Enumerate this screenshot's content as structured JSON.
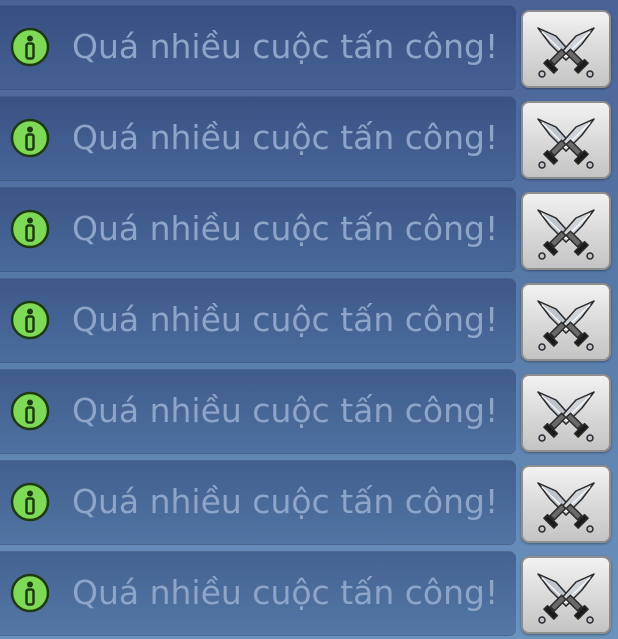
{
  "notifications": [
    {
      "message": "Quá nhiều cuộc tấn công!",
      "icon": "info-icon",
      "action_icon": "crossed-swords-icon"
    },
    {
      "message": "Quá nhiều cuộc tấn công!",
      "icon": "info-icon",
      "action_icon": "crossed-swords-icon"
    },
    {
      "message": "Quá nhiều cuộc tấn công!",
      "icon": "info-icon",
      "action_icon": "crossed-swords-icon"
    },
    {
      "message": "Quá nhiều cuộc tấn công!",
      "icon": "info-icon",
      "action_icon": "crossed-swords-icon"
    },
    {
      "message": "Quá nhiều cuộc tấn công!",
      "icon": "info-icon",
      "action_icon": "crossed-swords-icon"
    },
    {
      "message": "Quá nhiều cuộc tấn công!",
      "icon": "info-icon",
      "action_icon": "crossed-swords-icon"
    },
    {
      "message": "Quá nhiều cuộc tấn công!",
      "icon": "info-icon",
      "action_icon": "crossed-swords-icon"
    }
  ],
  "colors": {
    "info_icon_fill": "#7ed957",
    "info_icon_border": "#1e3a10",
    "message_text": "#8ea4c8",
    "button_face": "#d8d8d8"
  }
}
